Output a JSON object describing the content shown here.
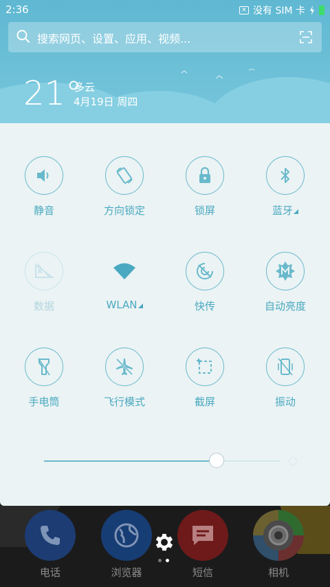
{
  "status_bar": {
    "time": "2:36",
    "carrier_text": "没有 SIM 卡",
    "sim_icon_glyph": "✕"
  },
  "search": {
    "placeholder": "搜索网页、设置、应用、视频..."
  },
  "weather": {
    "temperature": "21°",
    "condition": "多云",
    "date": "4月19日 周四"
  },
  "quick_settings": [
    {
      "label": "静音",
      "icon": "speaker-icon",
      "active": true
    },
    {
      "label": "方向锁定",
      "icon": "rotation-lock-icon",
      "active": true
    },
    {
      "label": "锁屏",
      "icon": "lock-icon",
      "active": true
    },
    {
      "label": "蓝牙",
      "icon": "bluetooth-icon",
      "active": true,
      "has_menu": true
    },
    {
      "label": "数据",
      "icon": "mobile-data-icon",
      "active": false
    },
    {
      "label": "WLAN",
      "icon": "wifi-icon",
      "active": true,
      "has_menu": true
    },
    {
      "label": "快传",
      "icon": "quick-transfer-icon",
      "active": true
    },
    {
      "label": "自动亮度",
      "icon": "auto-brightness-icon",
      "active": true
    },
    {
      "label": "手电筒",
      "icon": "flashlight-icon",
      "active": true
    },
    {
      "label": "飞行模式",
      "icon": "airplane-icon",
      "active": true
    },
    {
      "label": "截屏",
      "icon": "screenshot-icon",
      "active": true
    },
    {
      "label": "振动",
      "icon": "vibrate-icon",
      "active": true
    }
  ],
  "brightness": {
    "level": 0.73
  },
  "dock": [
    {
      "label": "电话",
      "icon": "phone-icon"
    },
    {
      "label": "浏览器",
      "icon": "globe-icon"
    },
    {
      "label": "短信",
      "icon": "message-icon"
    },
    {
      "label": "相机",
      "icon": "camera-icon"
    }
  ],
  "pager": {
    "pages": 2,
    "current": 2
  },
  "colors": {
    "accent": "#4aa9c0",
    "panel": "#ebf3f4",
    "sky": "#5fb8d2"
  }
}
